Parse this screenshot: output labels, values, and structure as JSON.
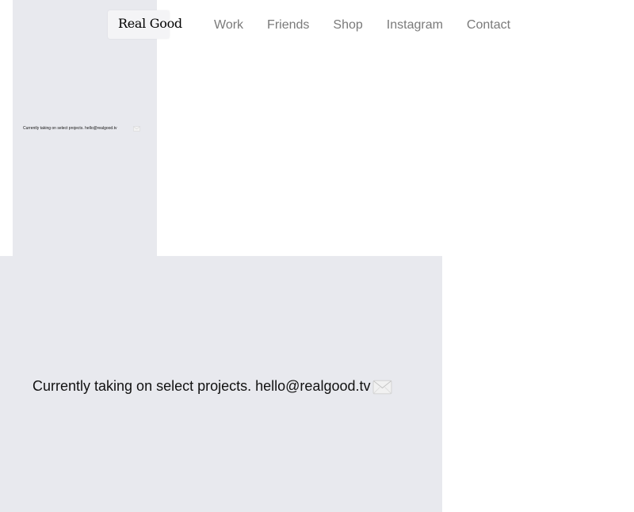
{
  "brand": {
    "name": "Real Good"
  },
  "nav": {
    "items": [
      {
        "label": "Work"
      },
      {
        "label": "Friends"
      },
      {
        "label": "Shop"
      },
      {
        "label": "Instagram"
      },
      {
        "label": "Contact"
      }
    ]
  },
  "preview": {
    "message": "Currently taking on select projects. hello@realgood.tv",
    "icon": "envelope-icon"
  },
  "contact_panel": {
    "message": "Currently taking on select projects. hello@realgood.tv",
    "icon": "envelope-icon"
  },
  "colors": {
    "panel_bg": "#e8e9ee",
    "nav_text": "#7a7a7a",
    "text": "#111111"
  }
}
